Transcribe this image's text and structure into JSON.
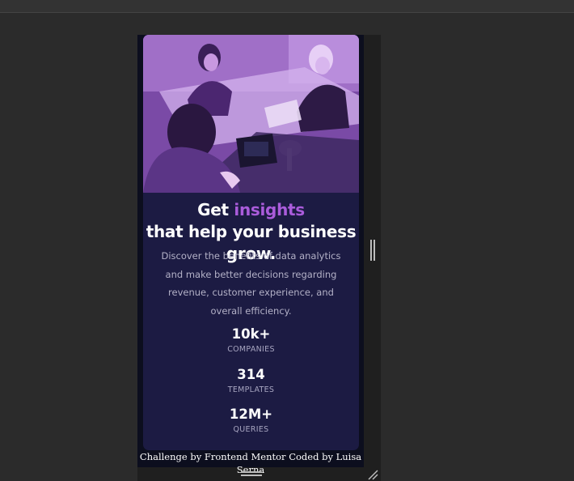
{
  "card": {
    "headline_start": "Get ",
    "headline_accent": "insights",
    "headline_end": " that help your business grow.",
    "description": "Discover the benefits of data analytics and make better decisions regarding revenue, customer experience, and overall efficiency.",
    "stats": [
      {
        "value": "10k+",
        "label": "COMPANIES"
      },
      {
        "value": "314",
        "label": "TEMPLATES"
      },
      {
        "value": "12M+",
        "label": "QUERIES"
      }
    ]
  },
  "attribution": "Challenge by Frontend Mentor Coded by Luisa Serna",
  "colors": {
    "page_bg": "#0c0e1e",
    "card_bg": "#1c1b43",
    "accent": "#aa5cdb",
    "image_overlay": "#8d5cc0",
    "text_main": "#ffffff",
    "text_muted": "#b3b1c7"
  },
  "icons": {
    "vertical_resize": "vertical-resize-handle-icon",
    "horizontal_resize": "horizontal-resize-handle-icon",
    "corner_resize": "corner-resize-grip-icon"
  }
}
